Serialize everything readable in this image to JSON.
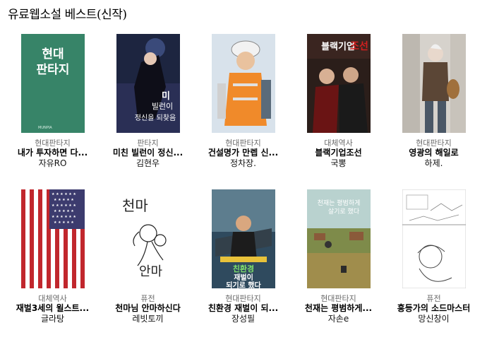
{
  "page": {
    "title": "유료웹소설 베스트(신작)"
  },
  "books": [
    {
      "genre": "현대판타지",
      "title": "내가 투자하면 다...",
      "author": "자유RO",
      "cover_text": "현대\n판타지",
      "cover_brand": "MUNPIA"
    },
    {
      "genre": "판타지",
      "title": "미친 빌런이 정신...",
      "author": "김현우",
      "cover_text": "미친 빌런이 정신을 되찾음"
    },
    {
      "genre": "현대판타지",
      "title": "건설명가 만렙 신...",
      "author": "정차장."
    },
    {
      "genre": "대체역사",
      "title": "블랙기업조선",
      "author": "국뽕",
      "cover_text": "블랙기업 조선"
    },
    {
      "genre": "현대판타지",
      "title": "영광의 해일로",
      "author": "하제."
    },
    {
      "genre": "대체역사",
      "title": "재벌3세의 윌스트...",
      "author": "글라탕"
    },
    {
      "genre": "퓨전",
      "title": "천마님 안마하신다",
      "author": "레빗토끼",
      "cover_text": "천마\n안마"
    },
    {
      "genre": "현대판타지",
      "title": "친환경 재벌이 되...",
      "author": "장성필",
      "cover_text": "친환경 재벌이 되기로 했다"
    },
    {
      "genre": "현대판타지",
      "title": "천재는 평범하게...",
      "author": "자손e",
      "cover_text": "천재는 평범하게 살기로 했다"
    },
    {
      "genre": "퓨전",
      "title": "흥등가의 소드마스터",
      "author": "망신창이"
    }
  ]
}
